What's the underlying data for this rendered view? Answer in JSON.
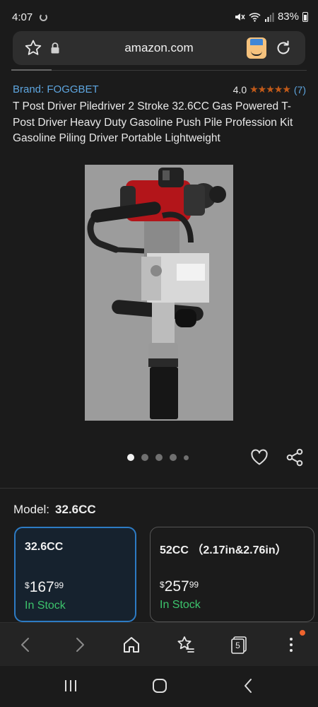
{
  "status_bar": {
    "time": "4:07",
    "battery": "83%"
  },
  "browser": {
    "url": "amazon.com"
  },
  "product": {
    "brand": "Brand: FOGGBET",
    "rating_value": "4.0",
    "rating_stars": "★★★★★",
    "rating_count": "(7)",
    "title": "T Post Driver Piledriver 2 Stroke 32.6CC Gas Powered T-Post Driver Heavy Duty Gasoline Push Pile Profession Kit Gasoline Piling Driver Portable Lightweight",
    "image_total": 5,
    "image_index": 1
  },
  "variation": {
    "label": "Model:",
    "selected": "32.6CC",
    "options": [
      {
        "name": "32.6CC",
        "currency": "$",
        "price_whole": "167",
        "price_fraction": "99",
        "availability": "In Stock"
      },
      {
        "name": "52CC （2.17in&2.76in）",
        "currency": "$",
        "price_whole": "257",
        "price_fraction": "99",
        "availability": "In Stock"
      }
    ]
  },
  "toolbar": {
    "tabs_count": "5"
  },
  "colors": {
    "link": "#5ea6e0",
    "star": "#c25a19",
    "in_stock": "#3cc46c",
    "selected_border": "#2d7bc4",
    "notification": "#f0642e"
  },
  "icons": [
    "bookmark-star-icon",
    "lock-icon",
    "amazon-app-icon",
    "reload-icon",
    "wishlist-heart-icon",
    "share-icon",
    "back-arrow-icon",
    "forward-arrow-icon",
    "home-icon",
    "bookmarks-icon",
    "tabs-icon",
    "menu-dots-icon",
    "recents-icon",
    "nav-home-icon",
    "nav-back-icon"
  ]
}
